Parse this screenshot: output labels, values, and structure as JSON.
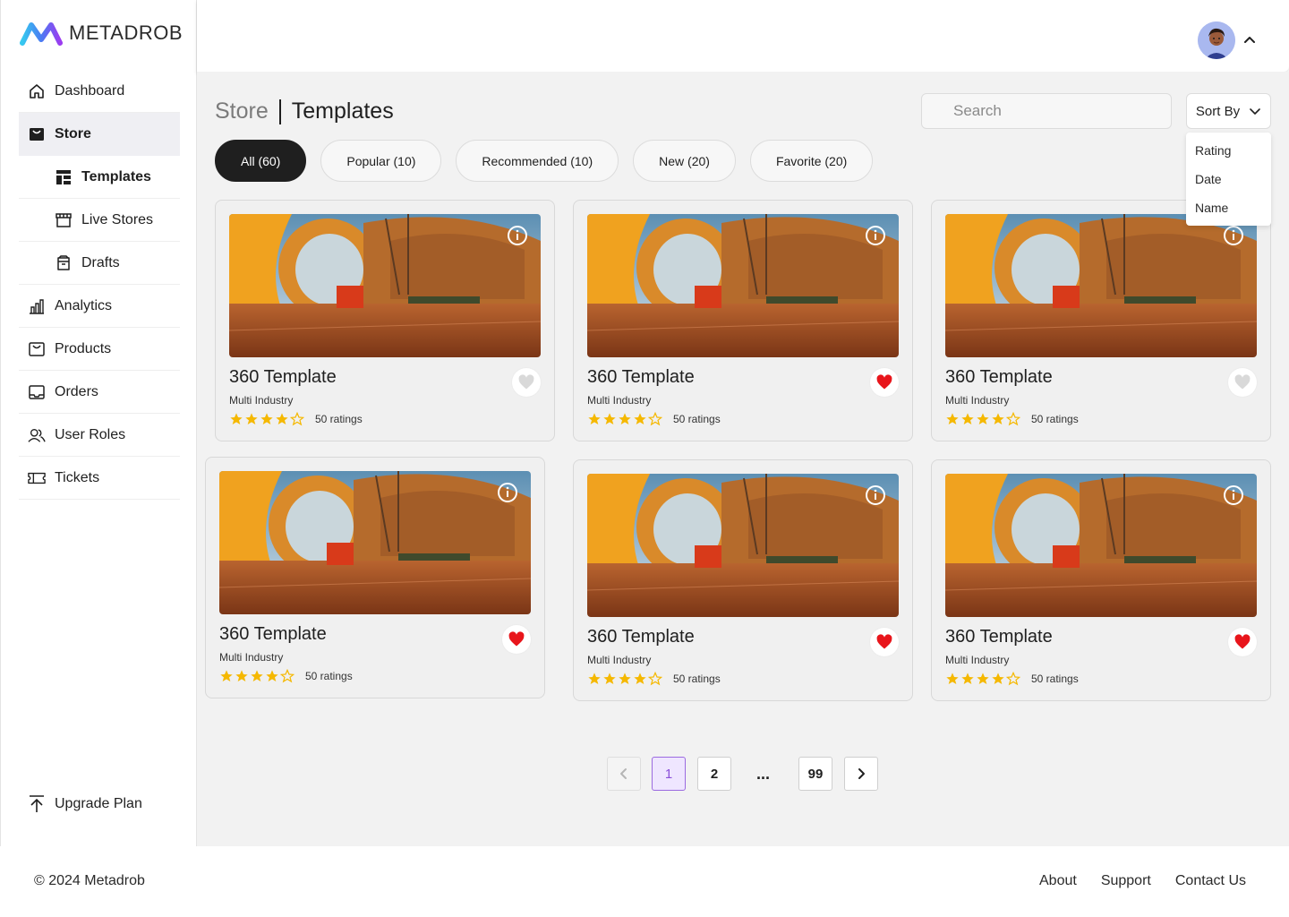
{
  "brand": {
    "name": "METADROB"
  },
  "sidebar": {
    "items": [
      {
        "label": "Dashboard",
        "icon": "home-icon"
      },
      {
        "label": "Store",
        "icon": "store-icon"
      },
      {
        "label": "Templates",
        "icon": "templates-icon"
      },
      {
        "label": "Live Stores",
        "icon": "storefront-icon"
      },
      {
        "label": "Drafts",
        "icon": "drafts-icon"
      },
      {
        "label": "Analytics",
        "icon": "bar-chart-icon"
      },
      {
        "label": "Products",
        "icon": "products-icon"
      },
      {
        "label": "Orders",
        "icon": "orders-icon"
      },
      {
        "label": "User Roles",
        "icon": "users-icon"
      },
      {
        "label": "Tickets",
        "icon": "ticket-icon"
      }
    ],
    "upgrade_label": "Upgrade Plan"
  },
  "header": {
    "avatar_icon": "user-avatar",
    "chevron": "chevron-up-icon"
  },
  "breadcrumb": {
    "parent": "Store",
    "current": "Templates"
  },
  "search": {
    "placeholder": "Search",
    "value": ""
  },
  "sort": {
    "label": "Sort By",
    "options": [
      "Rating",
      "Date",
      "Name"
    ]
  },
  "tabs": [
    {
      "label": "All (60)",
      "active": true
    },
    {
      "label": "Popular (10)",
      "active": false
    },
    {
      "label": "Recommended (10)",
      "active": false
    },
    {
      "label": "New (20)",
      "active": false
    },
    {
      "label": "Favorite (20)",
      "active": false
    }
  ],
  "cards": [
    {
      "title": "360 Template",
      "subtitle": "Multi Industry",
      "rating": 4,
      "ratings_label": "50 ratings",
      "favorite": false
    },
    {
      "title": "360 Template",
      "subtitle": "Multi Industry",
      "rating": 4,
      "ratings_label": "50 ratings",
      "favorite": true
    },
    {
      "title": "360 Template",
      "subtitle": "Multi Industry",
      "rating": 4,
      "ratings_label": "50 ratings",
      "favorite": false
    },
    {
      "title": "360 Template",
      "subtitle": "Multi Industry",
      "rating": 4,
      "ratings_label": "50 ratings",
      "favorite": true
    },
    {
      "title": "360 Template",
      "subtitle": "Multi Industry",
      "rating": 4,
      "ratings_label": "50 ratings",
      "favorite": true
    },
    {
      "title": "360 Template",
      "subtitle": "Multi Industry",
      "rating": 4,
      "ratings_label": "50 ratings",
      "favorite": true
    }
  ],
  "pagination": {
    "pages": [
      "1",
      "2",
      "...",
      "99"
    ],
    "current": "1"
  },
  "footer": {
    "copyright": "© 2024  Metadrob",
    "links": [
      "About",
      "Support",
      "Contact Us"
    ]
  },
  "colors": {
    "accent": "#8a4fd9",
    "star": "#f5b800",
    "heart": "#e8151b",
    "active_tab": "#1f1f1f"
  }
}
